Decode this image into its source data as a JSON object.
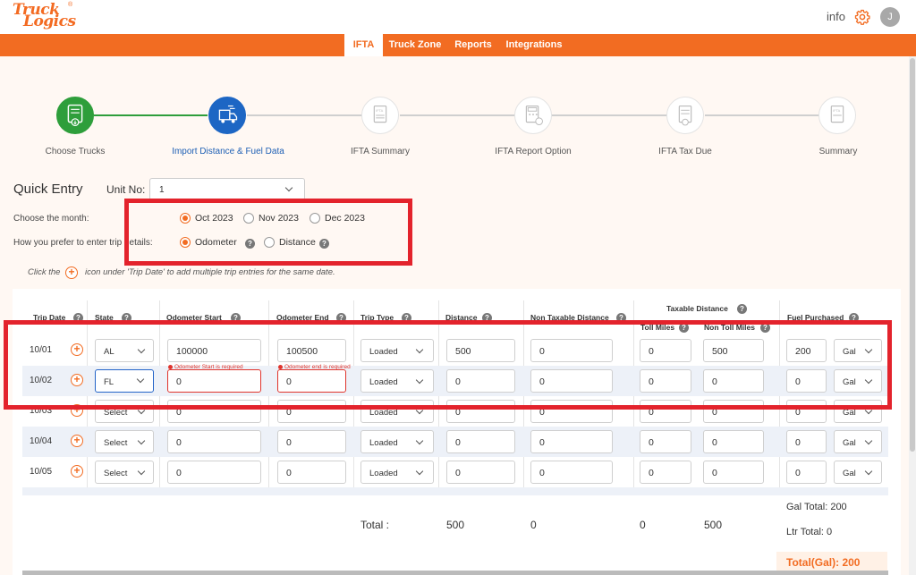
{
  "header": {
    "logo_line1": "Truck",
    "logo_line2": "Logics",
    "logo_reg": "®",
    "info_label": "info",
    "avatar_initial": "J"
  },
  "nav": {
    "items": [
      "IFTA",
      "Truck Zone",
      "Reports",
      "Integrations"
    ]
  },
  "stepper": {
    "steps": [
      {
        "label": "Choose Trucks",
        "state": "done"
      },
      {
        "label": "Import Distance & Fuel Data",
        "state": "current"
      },
      {
        "label": "IFTA Summary",
        "state": "pending"
      },
      {
        "label": "IFTA Report Option",
        "state": "pending"
      },
      {
        "label": "IFTA Tax Due",
        "state": "pending"
      },
      {
        "label": "Summary",
        "state": "pending"
      }
    ]
  },
  "quick_entry": {
    "title": "Quick Entry",
    "unit_label": "Unit No:",
    "unit_value": "1",
    "month_label": "Choose the month:",
    "months": [
      "Oct 2023",
      "Nov 2023",
      "Dec 2023"
    ],
    "selected_month": "Oct 2023",
    "method_label": "How you prefer to enter trip details:",
    "methods": [
      "Odometer",
      "Distance"
    ],
    "selected_method": "Odometer",
    "hint_before": "Click the",
    "hint_after": "icon under 'Trip Date' to add multiple trip entries for the same date."
  },
  "table": {
    "headers": {
      "trip_date": "Trip Date",
      "state": "State",
      "odometer_start": "Odometer Start",
      "odometer_end": "Odometer End",
      "trip_type": "Trip Type",
      "distance": "Distance",
      "non_taxable": "Non Taxable Distance",
      "taxable_group": "Taxable Distance",
      "toll_miles": "Toll Miles",
      "non_toll_miles": "Non Toll Miles",
      "fuel_purchased": "Fuel Purchased"
    },
    "rows": [
      {
        "date": "10/01",
        "state": "AL",
        "odo_start": "100000",
        "odo_end": "100500",
        "trip_type": "Loaded",
        "distance": "500",
        "non_taxable": "0",
        "toll": "0",
        "non_toll": "500",
        "fuel": "200",
        "unit": "Gal"
      },
      {
        "date": "10/02",
        "state": "FL",
        "odo_start": "0",
        "odo_end": "0",
        "trip_type": "Loaded",
        "distance": "0",
        "non_taxable": "0",
        "toll": "0",
        "non_toll": "0",
        "fuel": "0",
        "unit": "Gal",
        "err_start": "Odometer Start is required",
        "err_end": "Odometer end is required"
      },
      {
        "date": "10/03",
        "state": "Select",
        "odo_start": "0",
        "odo_end": "0",
        "trip_type": "Loaded",
        "distance": "0",
        "non_taxable": "0",
        "toll": "0",
        "non_toll": "0",
        "fuel": "0",
        "unit": "Gal"
      },
      {
        "date": "10/04",
        "state": "Select",
        "odo_start": "0",
        "odo_end": "0",
        "trip_type": "Loaded",
        "distance": "0",
        "non_taxable": "0",
        "toll": "0",
        "non_toll": "0",
        "fuel": "0",
        "unit": "Gal"
      },
      {
        "date": "10/05",
        "state": "Select",
        "odo_start": "0",
        "odo_end": "0",
        "trip_type": "Loaded",
        "distance": "0",
        "non_taxable": "0",
        "toll": "0",
        "non_toll": "0",
        "fuel": "0",
        "unit": "Gal"
      }
    ],
    "totals": {
      "label": "Total :",
      "distance": "500",
      "non_taxable": "0",
      "toll": "0",
      "non_toll": "500",
      "gal_total": "Gal Total: 200",
      "ltr_total": "Ltr Total: 0",
      "total_gal": "Total(Gal): 200"
    }
  },
  "colors": {
    "brand": "#f26c22",
    "step_done": "#2e9e3b",
    "step_current": "#1d66c4",
    "highlight_box": "#e3232c",
    "error": "#e0342c"
  }
}
